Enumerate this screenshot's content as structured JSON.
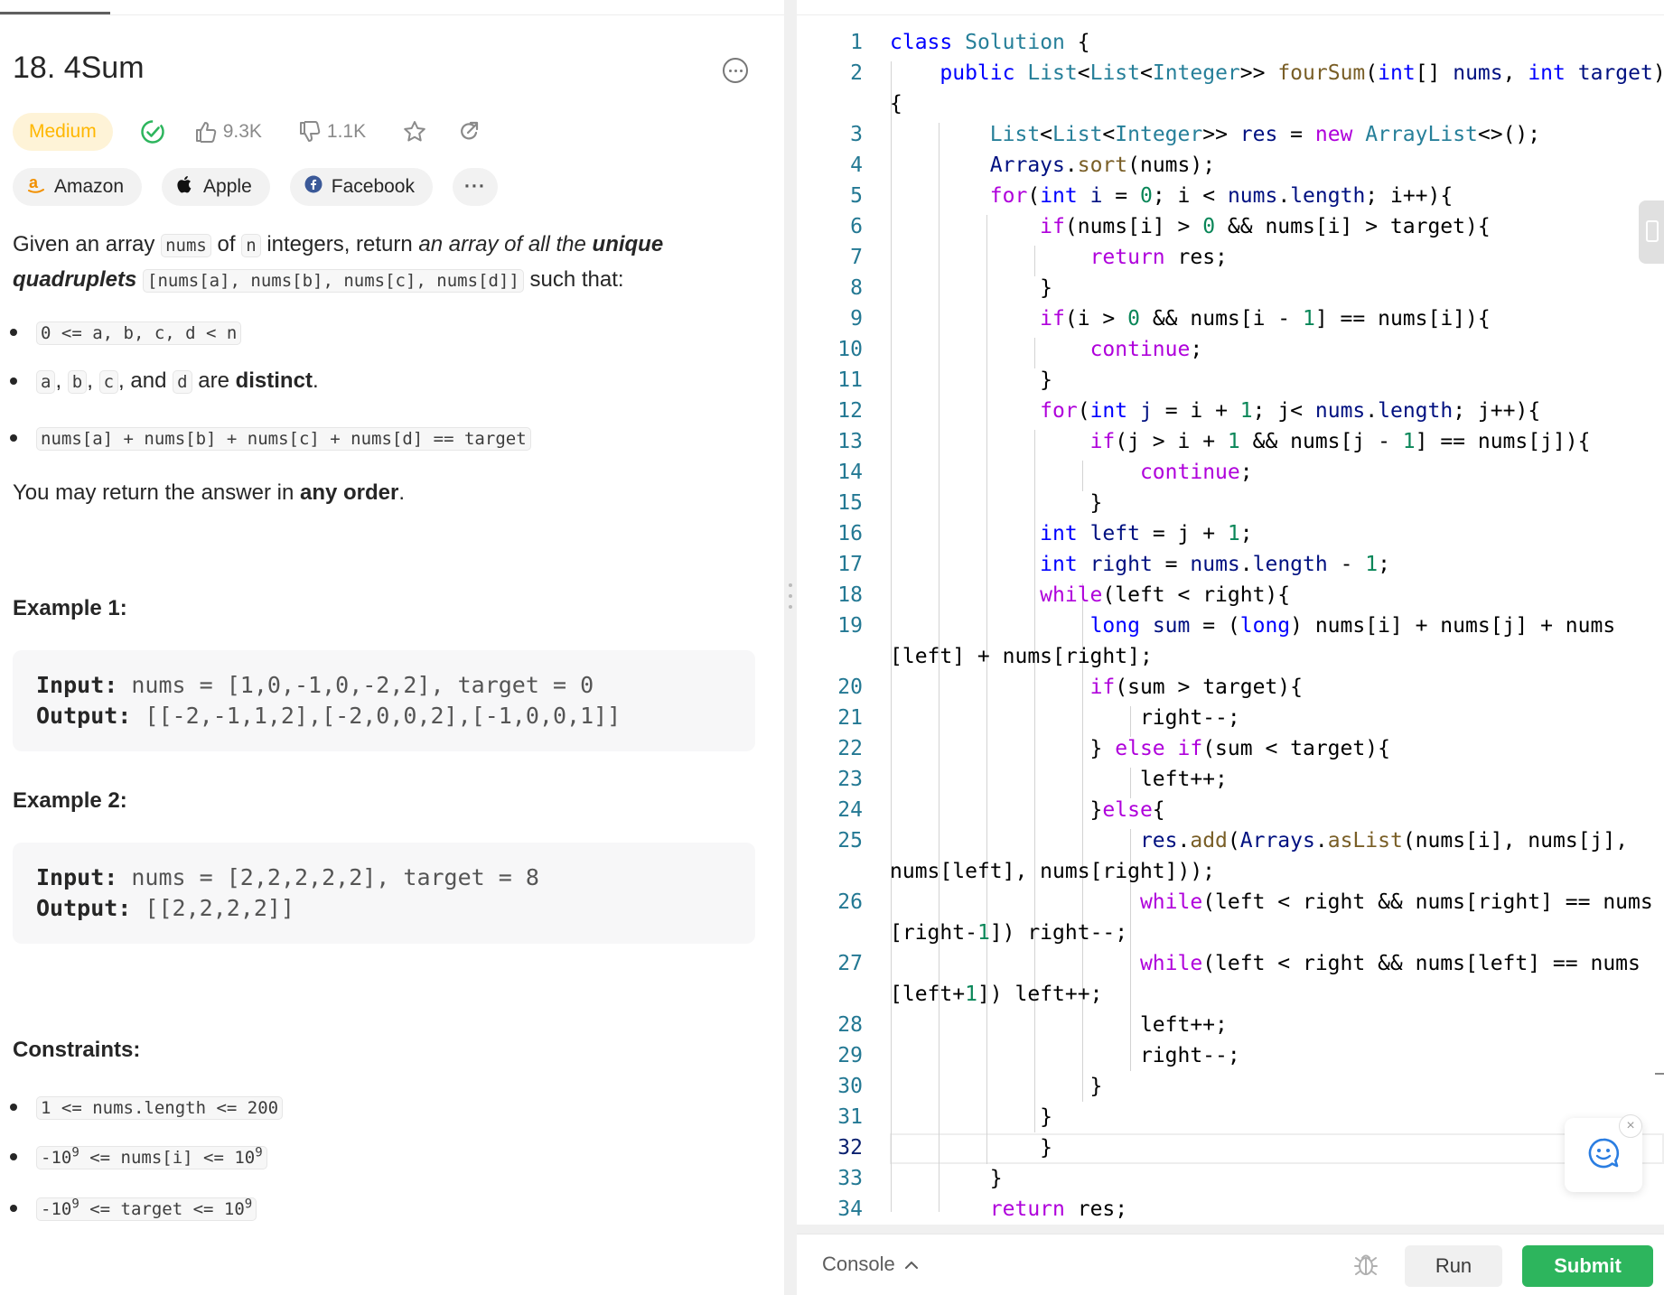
{
  "problem": {
    "title": "18. 4Sum",
    "difficulty": "Medium",
    "likes": "9.3K",
    "dislikes": "1.1K",
    "companies": [
      "Amazon",
      "Apple",
      "Facebook"
    ],
    "more_companies": "···",
    "description": {
      "p1": "Given an array",
      "c_nums": "nums",
      "p2": "of",
      "c_n": "n",
      "p3": "integers, return",
      "p4": "an array of all the",
      "p5": "unique quadruplets",
      "c_quad": "[nums[a], nums[b], nums[c], nums[d]]",
      "p6": "such that:"
    },
    "conditions": {
      "c1": "0 <= a, b, c, d < n",
      "c2_a": "a",
      "c2_b": "b",
      "c2_c": "c",
      "c2_and": ", and",
      "c2_d": "d",
      "c2_are": "are",
      "c2_distinct": "distinct",
      "c3": "nums[a] + nums[b] + nums[c] + nums[d] == target"
    },
    "order_note": {
      "text": "You may return the answer in",
      "bold": "any order"
    },
    "examples": [
      {
        "heading": "Example 1:",
        "input_label": "Input:",
        "input": "nums = [1,0,-1,0,-2,2], target = 0",
        "output_label": "Output:",
        "output": "[[-2,-1,1,2],[-2,0,0,2],[-1,0,0,1]]"
      },
      {
        "heading": "Example 2:",
        "input_label": "Input:",
        "input": "nums = [2,2,2,2,2], target = 8",
        "output_label": "Output:",
        "output": "[[2,2,2,2]]"
      }
    ],
    "constraints_heading": "Constraints:",
    "constraints": {
      "k1": "1 <= nums.length <= 200",
      "k2_a": "-10",
      "k2_e1": "9",
      "k2_b": " <= nums[i] <= 10",
      "k2_e2": "9",
      "k3_a": "-10",
      "k3_e1": "9",
      "k3_b": " <= target <= 10",
      "k3_e2": "9"
    }
  },
  "editor": {
    "line_numbers": [
      "1",
      "2",
      "3",
      "4",
      "5",
      "6",
      "7",
      "8",
      "9",
      "10",
      "11",
      "12",
      "13",
      "14",
      "15",
      "16",
      "17",
      "18",
      "19",
      "20",
      "21",
      "22",
      "23",
      "24",
      "25",
      "26",
      "27",
      "28",
      "29",
      "30",
      "31",
      "32",
      "33",
      "34"
    ],
    "active_line": "32"
  },
  "console": {
    "label": "Console",
    "run": "Run",
    "submit": "Submit"
  },
  "colors": {
    "accent_green": "#2db55d",
    "medium": "#ffb700",
    "solved_check": "#2db55d"
  }
}
